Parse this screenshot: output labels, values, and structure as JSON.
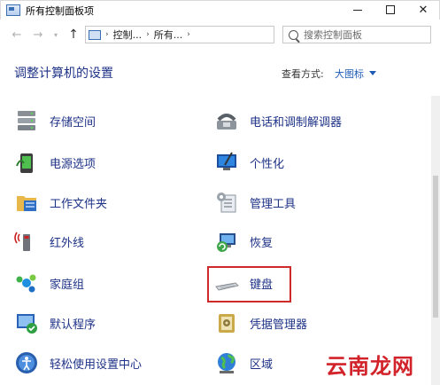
{
  "window": {
    "title": "所有控制面板项"
  },
  "address": {
    "crumbs": [
      "控制...",
      "所有...",
      ""
    ]
  },
  "search": {
    "placeholder": "搜索控制面板"
  },
  "header": {
    "title": "调整计算机的设置",
    "view_by_label": "查看方式:",
    "view_by_value": "大图标"
  },
  "left_items": [
    {
      "label": "存储空间",
      "icon": "storage-spaces-icon"
    },
    {
      "label": "电源选项",
      "icon": "power-options-icon"
    },
    {
      "label": "工作文件夹",
      "icon": "work-folders-icon"
    },
    {
      "label": "红外线",
      "icon": "infrared-icon"
    },
    {
      "label": "家庭组",
      "icon": "homegroup-icon"
    },
    {
      "label": "默认程序",
      "icon": "default-programs-icon"
    },
    {
      "label": "轻松使用设置中心",
      "icon": "ease-of-access-icon"
    }
  ],
  "right_items": [
    {
      "label": "电话和调制解调器",
      "icon": "phone-modem-icon"
    },
    {
      "label": "个性化",
      "icon": "personalization-icon"
    },
    {
      "label": "管理工具",
      "icon": "admin-tools-icon"
    },
    {
      "label": "恢复",
      "icon": "recovery-icon"
    },
    {
      "label": "键盘",
      "icon": "keyboard-icon"
    },
    {
      "label": "凭据管理器",
      "icon": "credential-manager-icon"
    },
    {
      "label": "区域",
      "icon": "region-icon"
    }
  ],
  "watermark": "云南龙网",
  "colors": {
    "link": "#1e3287",
    "accent": "#1e5bb5",
    "highlight": "#cf2a2a"
  }
}
